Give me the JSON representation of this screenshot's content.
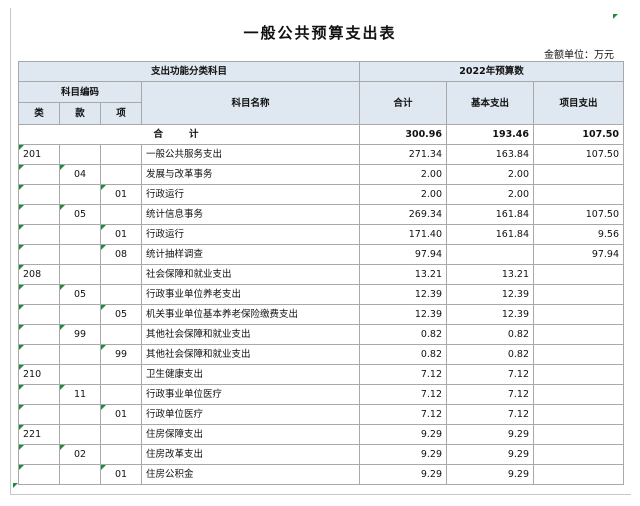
{
  "title": "一般公共预算支出表",
  "unit": "金额单位：万元",
  "header": {
    "group_function": "支出功能分类科目",
    "group_budget": "2022年预算数",
    "subject_code": "科目编码",
    "lei": "类",
    "kuan": "款",
    "xiang": "项",
    "subject_name": "科目名称",
    "total": "合计",
    "basic": "基本支出",
    "project": "项目支出"
  },
  "total_row": {
    "label": "合计",
    "total": "300.96",
    "basic": "193.46",
    "project": "107.50"
  },
  "rows": [
    {
      "lei": "201",
      "kuan": "",
      "xiang": "",
      "name": "一般公共服务支出",
      "total": "271.34",
      "basic": "163.84",
      "project": "107.50"
    },
    {
      "lei": "",
      "kuan": "04",
      "xiang": "",
      "name": "发展与改革事务",
      "total": "2.00",
      "basic": "2.00",
      "project": ""
    },
    {
      "lei": "",
      "kuan": "",
      "xiang": "01",
      "name": "行政运行",
      "total": "2.00",
      "basic": "2.00",
      "project": ""
    },
    {
      "lei": "",
      "kuan": "05",
      "xiang": "",
      "name": "统计信息事务",
      "total": "269.34",
      "basic": "161.84",
      "project": "107.50"
    },
    {
      "lei": "",
      "kuan": "",
      "xiang": "01",
      "name": "行政运行",
      "total": "171.40",
      "basic": "161.84",
      "project": "9.56"
    },
    {
      "lei": "",
      "kuan": "",
      "xiang": "08",
      "name": "统计抽样调查",
      "total": "97.94",
      "basic": "",
      "project": "97.94"
    },
    {
      "lei": "208",
      "kuan": "",
      "xiang": "",
      "name": "社会保障和就业支出",
      "total": "13.21",
      "basic": "13.21",
      "project": ""
    },
    {
      "lei": "",
      "kuan": "05",
      "xiang": "",
      "name": "行政事业单位养老支出",
      "total": "12.39",
      "basic": "12.39",
      "project": ""
    },
    {
      "lei": "",
      "kuan": "",
      "xiang": "05",
      "name": "机关事业单位基本养老保险缴费支出",
      "total": "12.39",
      "basic": "12.39",
      "project": ""
    },
    {
      "lei": "",
      "kuan": "99",
      "xiang": "",
      "name": "其他社会保障和就业支出",
      "total": "0.82",
      "basic": "0.82",
      "project": ""
    },
    {
      "lei": "",
      "kuan": "",
      "xiang": "99",
      "name": "其他社会保障和就业支出",
      "total": "0.82",
      "basic": "0.82",
      "project": ""
    },
    {
      "lei": "210",
      "kuan": "",
      "xiang": "",
      "name": "卫生健康支出",
      "total": "7.12",
      "basic": "7.12",
      "project": ""
    },
    {
      "lei": "",
      "kuan": "11",
      "xiang": "",
      "name": "行政事业单位医疗",
      "total": "7.12",
      "basic": "7.12",
      "project": ""
    },
    {
      "lei": "",
      "kuan": "",
      "xiang": "01",
      "name": "行政单位医疗",
      "total": "7.12",
      "basic": "7.12",
      "project": ""
    },
    {
      "lei": "221",
      "kuan": "",
      "xiang": "",
      "name": "住房保障支出",
      "total": "9.29",
      "basic": "9.29",
      "project": ""
    },
    {
      "lei": "",
      "kuan": "02",
      "xiang": "",
      "name": "住房改革支出",
      "total": "9.29",
      "basic": "9.29",
      "project": ""
    },
    {
      "lei": "",
      "kuan": "",
      "xiang": "01",
      "name": "住房公积金",
      "total": "9.29",
      "basic": "9.29",
      "project": ""
    }
  ]
}
